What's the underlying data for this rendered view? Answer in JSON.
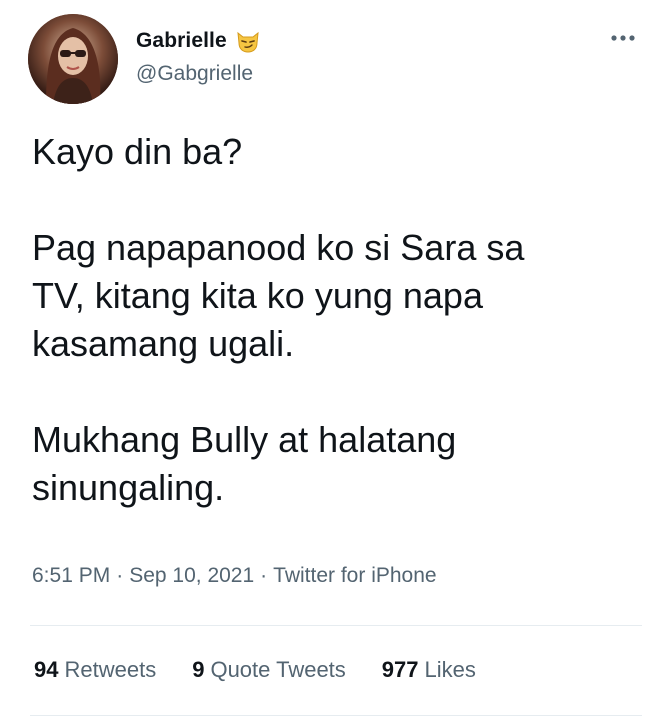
{
  "author": {
    "name": "Gabrielle",
    "handle": "@Gabgrielle",
    "name_emoji": "smirking-cat-emoji"
  },
  "tweet": {
    "lines": [
      "Kayo din ba?",
      "",
      "Pag napapanood ko si Sara sa",
      "TV, kitang kita ko yung napa",
      "kasamang ugali.",
      "",
      "Mukhang Bully at halatang",
      "sinungaling."
    ]
  },
  "meta": {
    "time": "6:51 PM",
    "separator": "·",
    "date": "Sep 10, 2021",
    "source": "Twitter for iPhone"
  },
  "stats": {
    "retweets_count": "94",
    "retweets_label": "Retweets",
    "quotes_count": "9",
    "quotes_label": "Quote Tweets",
    "likes_count": "977",
    "likes_label": "Likes"
  },
  "colors": {
    "text_primary": "#0f1419",
    "text_secondary": "#536471",
    "divider": "#e6ecf0"
  },
  "icons": {
    "more": "more-horizontal-icon",
    "avatar": "profile-photo"
  }
}
